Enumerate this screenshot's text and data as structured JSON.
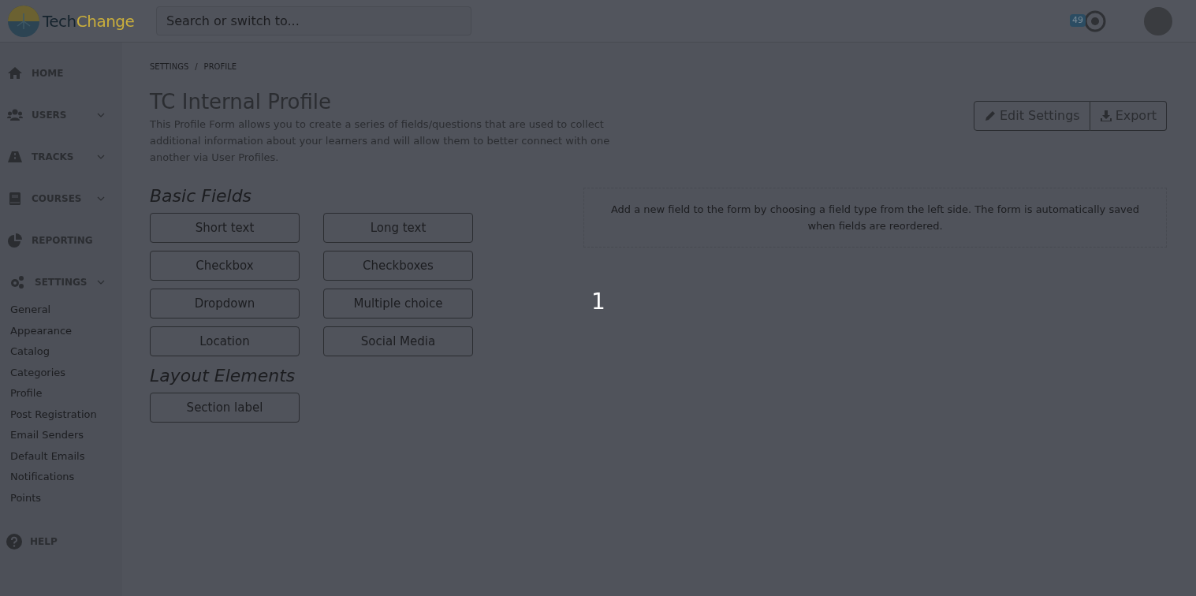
{
  "header": {
    "logo_text_1": "Tech",
    "logo_text_2": "Change",
    "search": {
      "placeholder": "Search or switch to..."
    },
    "notification_count": "49"
  },
  "sidebar": {
    "items": [
      {
        "label": "HOME",
        "kind": "link"
      },
      {
        "label": "USERS",
        "kind": "menu"
      },
      {
        "label": "TRACKS",
        "kind": "menu"
      },
      {
        "label": "COURSES",
        "kind": "menu"
      },
      {
        "label": "REPORTING",
        "kind": "link"
      },
      {
        "label": "SETTINGS",
        "kind": "menu",
        "children": [
          {
            "label": "General"
          },
          {
            "label": "Appearance"
          },
          {
            "label": "Catalog"
          },
          {
            "label": "Categories"
          },
          {
            "label": "Profile"
          },
          {
            "label": "Post Registration"
          },
          {
            "label": "Email Senders"
          },
          {
            "label": "Default Emails"
          },
          {
            "label": "Notifications"
          },
          {
            "label": "Points"
          }
        ]
      }
    ],
    "help": "HELP"
  },
  "breadcrumb": [
    "SETTINGS",
    "PROFILE"
  ],
  "breadcrumb_separator": "/",
  "title": "TC Internal Profile",
  "description": "This Profile Form allows you to create a series of fields/questions that are used to collect additional information about your learners and will allow them to better connect with one another via User Profiles.",
  "actions": [
    {
      "label": "Edit Settings"
    },
    {
      "label": "Export"
    }
  ],
  "groups": [
    {
      "title": "Basic Fields",
      "buttons": [
        "Short text",
        "Long text",
        "Checkbox",
        "Checkboxes",
        "Dropdown",
        "Multiple choice",
        "Location",
        "Social Media"
      ]
    },
    {
      "title": "Layout Elements",
      "buttons": [
        "Section label"
      ]
    }
  ],
  "dropzone_hint": "Add a new field to the form by choosing a field type from the left side. The form is automatically saved when fields are reordered.",
  "overlay_counter": "1"
}
